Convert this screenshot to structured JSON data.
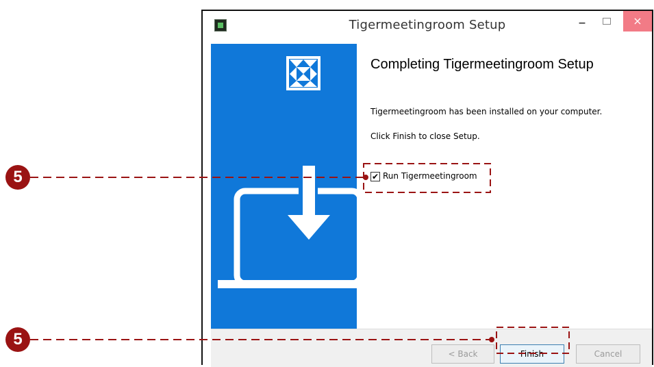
{
  "window": {
    "title": "Tigermeetingroom Setup",
    "minimize": "–",
    "close": "×"
  },
  "content": {
    "heading": "Completing Tigermeetingroom Setup",
    "message_installed": "Tigermeetingroom has been installed on your computer.",
    "message_finish": "Click Finish to close Setup.",
    "run_checkbox": {
      "label": "Run Tigermeetingroom",
      "checked": true,
      "check_glyph": "✔"
    }
  },
  "footer": {
    "back_label": "< Back",
    "finish_label": "Finish",
    "cancel_label": "Cancel"
  },
  "annotations": {
    "step_number": "5",
    "color": "#9a1313"
  },
  "colors": {
    "banner_blue": "#1078d9",
    "close_red": "#f27b86"
  }
}
